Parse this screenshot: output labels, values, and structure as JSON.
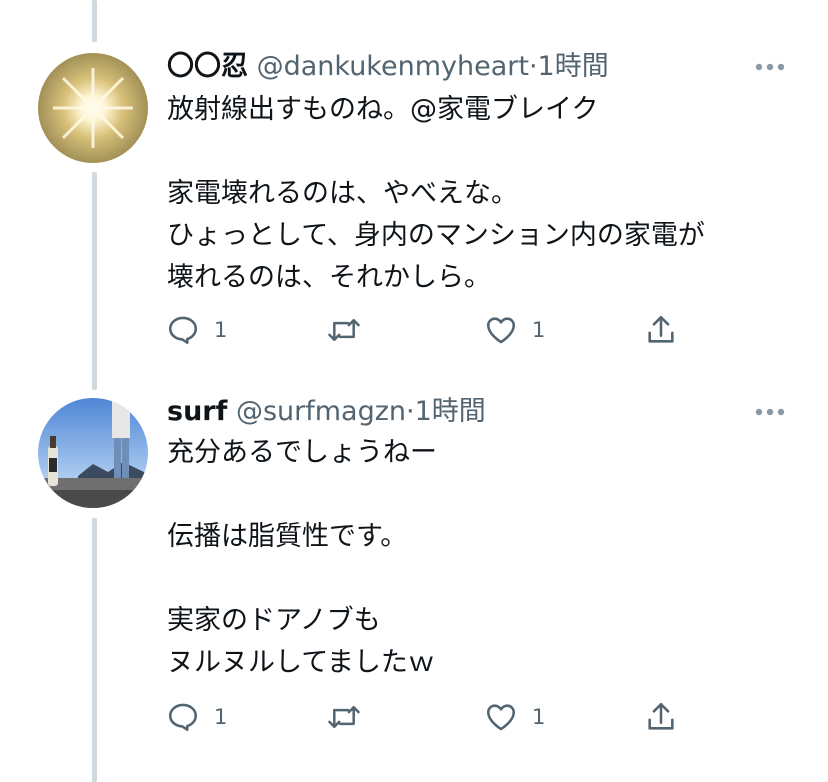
{
  "tweets": [
    {
      "display_name": "〇〇忍",
      "handle": "@dankukenmyheart",
      "separator": "·",
      "time": "1時間",
      "lines": [
        "放射線出すものね。@家電ブレイク",
        "",
        "家電壊れるのは、やべえな。",
        "ひょっとして、身内のマンション内の家電が",
        "壊れるのは、それかしら。"
      ],
      "reply_count": "1",
      "retweet_count": "",
      "like_count": "1"
    },
    {
      "display_name": "surf",
      "handle": "@surfmagzn",
      "separator": "·",
      "time": "1時間",
      "lines": [
        "充分あるでしょうねー",
        "",
        "伝播は脂質性です。",
        "",
        "実家のドアノブも",
        "ヌルヌルしてましたｗ"
      ],
      "reply_count": "1",
      "retweet_count": "",
      "like_count": "1"
    }
  ],
  "colors": {
    "text": "#0f1419",
    "secondary": "#536471",
    "thread_line": "#cfd9de",
    "background": "#ffffff"
  },
  "icons": [
    "reply-icon",
    "retweet-icon",
    "like-icon",
    "share-icon",
    "more-icon"
  ]
}
